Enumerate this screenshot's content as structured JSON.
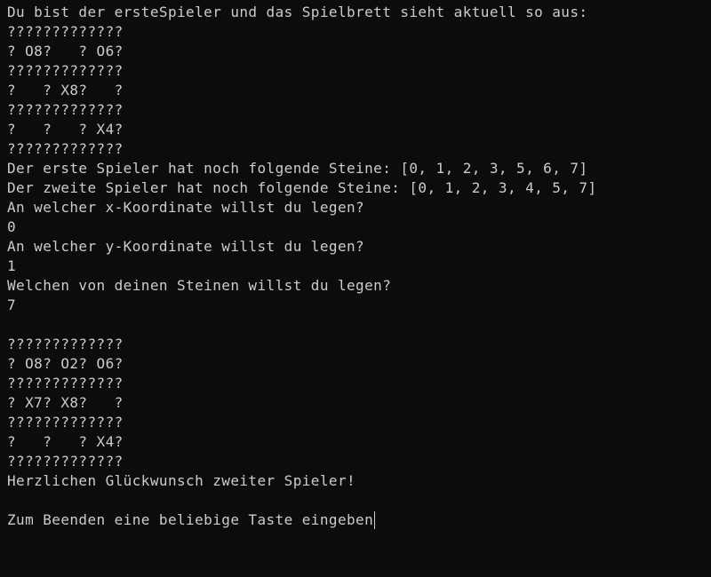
{
  "terminal": {
    "lines": [
      "Du bist der ersteSpieler und das Spielbrett sieht aktuell so aus:",
      "?????????????",
      "? O8?   ? O6?",
      "?????????????",
      "?   ? X8?   ?",
      "?????????????",
      "?   ?   ? X4?",
      "?????????????",
      "Der erste Spieler hat noch folgende Steine: [0, 1, 2, 3, 5, 6, 7]",
      "Der zweite Spieler hat noch folgende Steine: [0, 1, 2, 3, 4, 5, 7]",
      "An welcher x-Koordinate willst du legen?",
      "0",
      "An welcher y-Koordinate willst du legen?",
      "1",
      "Welchen von deinen Steinen willst du legen?",
      "7",
      "",
      "?????????????",
      "? O8? O2? O6?",
      "?????????????",
      "? X7? X8?   ?",
      "?????????????",
      "?   ?   ? X4?",
      "?????????????",
      "Herzlichen Glückwunsch zweiter Spieler!",
      "",
      "Zum Beenden eine beliebige Taste eingeben"
    ]
  }
}
